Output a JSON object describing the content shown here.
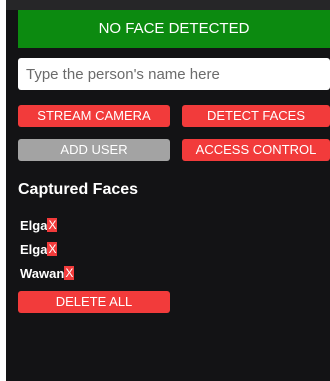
{
  "status": {
    "text": "NO FACE DETECTED",
    "color": "#0c8a10"
  },
  "name_input": {
    "placeholder": "Type the person's name here",
    "value": ""
  },
  "buttons": {
    "stream_camera": "STREAM CAMERA",
    "detect_faces": "DETECT FACES",
    "add_user": "ADD USER",
    "access_control": "ACCESS CONTROL",
    "delete_all": "DELETE ALL"
  },
  "captured": {
    "title": "Captured Faces",
    "faces": [
      {
        "name": "Elga",
        "remove": "X"
      },
      {
        "name": "Elga",
        "remove": "X"
      },
      {
        "name": "Wawan",
        "remove": "X"
      }
    ]
  },
  "colors": {
    "background": "#131315",
    "button_red": "#f23b3b",
    "button_gray": "#a3a3a3"
  }
}
